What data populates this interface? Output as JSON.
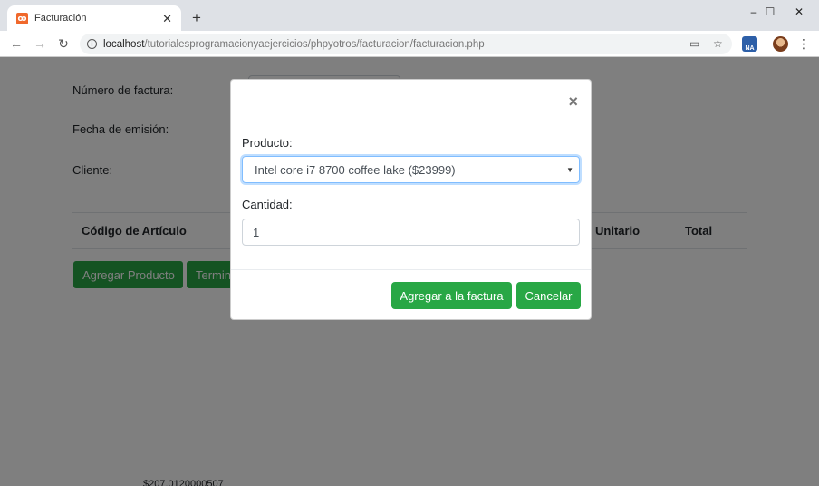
{
  "browser": {
    "tab_title": "Facturación",
    "tab_close": "✕",
    "new_tab": "+",
    "favicon_letter": "ꝏ",
    "url_host": "localhost",
    "url_path": "/tutorialesprogramacionyaejercicios/phpyotros/facturacion/facturacion.php",
    "ext_label": "NA",
    "window_controls": [
      "–",
      "☐",
      "✕"
    ],
    "nav": {
      "back": "←",
      "forward": "→",
      "reload": "↻"
    },
    "icons": [
      "info-icon",
      "cast-icon",
      "star-icon",
      "extension-icon",
      "avatar-icon",
      "menu-icon"
    ]
  },
  "page": {
    "labels": {
      "invoice_number": "Número de factura:",
      "issue_date": "Fecha de emisión:",
      "client": "Cliente:"
    },
    "table_headers": [
      "Código de Artículo",
      "Unitario",
      "Total"
    ],
    "buttons": {
      "add_product": "Agregar Producto",
      "finish": "Termin"
    },
    "footer_partial": "$207.0120000507"
  },
  "modal": {
    "close": "×",
    "product_label": "Producto:",
    "product_selected": "Intel core i7 8700 coffee lake ($23999)",
    "quantity_label": "Cantidad:",
    "quantity_value": "1",
    "add_button": "Agregar a la factura",
    "cancel_button": "Cancelar"
  },
  "colors": {
    "success": "#28a745",
    "backdrop": "rgba(0,0,0,0.5)",
    "focus": "#80bdff"
  }
}
